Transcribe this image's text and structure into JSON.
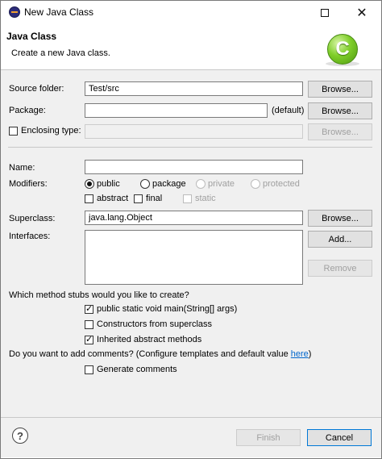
{
  "window": {
    "title": "New Java Class"
  },
  "header": {
    "title": "Java Class",
    "message": "Create a new Java class."
  },
  "form": {
    "source_folder": {
      "label": "Source folder:",
      "value": "Test/src",
      "browse_label": "Browse..."
    },
    "package": {
      "label": "Package:",
      "value": "",
      "default_text": "(default)",
      "browse_label": "Browse..."
    },
    "enclosing_type": {
      "label": "Enclosing type:",
      "checked": false,
      "value": "",
      "browse_label": "Browse..."
    },
    "name": {
      "label": "Name:",
      "value": ""
    },
    "modifiers": {
      "label": "Modifiers:",
      "public": "public",
      "package": "package",
      "private": "private",
      "protected": "protected",
      "abstract": "abstract",
      "final": "final",
      "static": "static"
    },
    "superclass": {
      "label": "Superclass:",
      "value": "java.lang.Object",
      "browse_label": "Browse..."
    },
    "interfaces": {
      "label": "Interfaces:",
      "add_label": "Add...",
      "remove_label": "Remove"
    },
    "stubs": {
      "question": "Which method stubs would you like to create?",
      "main": "public static void main(String[] args)",
      "constructors": "Constructors from superclass",
      "inherited": "Inherited abstract methods"
    },
    "comments": {
      "question_prefix": "Do you want to add comments? (Configure templates and default value ",
      "link": "here",
      "question_suffix": ")",
      "generate": "Generate comments"
    }
  },
  "footer": {
    "help_symbol": "?",
    "finish_label": "Finish",
    "cancel_label": "Cancel"
  }
}
